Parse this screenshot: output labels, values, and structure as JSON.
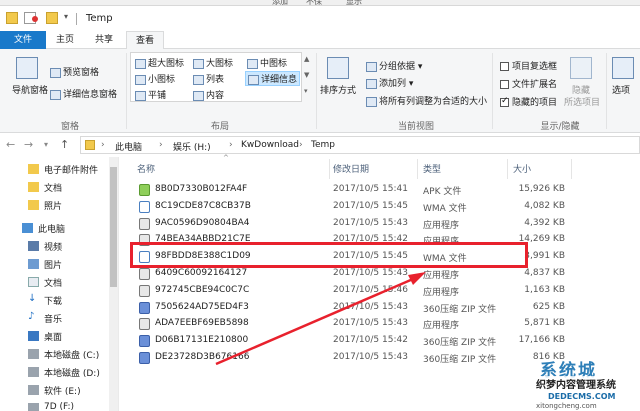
{
  "topstrip": {
    "t1": "添加",
    "t2": "不保",
    "t3": "显示"
  },
  "window": {
    "title": "Temp"
  },
  "tabs": [
    "文件",
    "主页",
    "共享",
    "查看"
  ],
  "ribbon": {
    "nav_pane": "导航窗格",
    "preview_pane": "预览窗格",
    "details_pane": "详细信息窗格",
    "group_panes": "窗格",
    "layout": {
      "extra_large": "超大图标",
      "large": "大图标",
      "medium": "中图标",
      "small": "小图标",
      "list": "列表",
      "details": "详细信息",
      "tiles": "平铺",
      "content": "内容"
    },
    "group_layout": "布局",
    "sort_by": "排序方式",
    "group_by": "分组依据",
    "add_columns": "添加列",
    "size_columns": "将所有列调整为合适的大小",
    "group_current_view": "当前视图",
    "item_checkboxes": "项目复选框",
    "file_extensions": "文件扩展名",
    "hidden_items": "隐藏的项目",
    "hide_selected": "隐藏",
    "hide_selected2": "所选项目",
    "options": "选项",
    "group_show_hide": "显示/隐藏"
  },
  "breadcrumb": [
    "此电脑",
    "娱乐 (H:)",
    "KwDownload",
    "Temp"
  ],
  "sidebar": {
    "items": [
      "电子邮件附件",
      "文档",
      "照片",
      "此电脑",
      "视频",
      "图片",
      "文档",
      "下载",
      "音乐",
      "桌面",
      "本地磁盘 (C:)",
      "本地磁盘 (D:)",
      "软件 (E:)",
      "7D (F:)"
    ]
  },
  "columns": {
    "name": "名称",
    "date": "修改日期",
    "type": "类型",
    "size": "大小"
  },
  "files": [
    {
      "name": "8B0D7330B012FA4F",
      "date": "2017/10/5 15:41",
      "type": "APK 文件",
      "size": "15,926 KB"
    },
    {
      "name": "8C19CDE87C8CB37B",
      "date": "2017/10/5 15:45",
      "type": "WMA 文件",
      "size": "4,082 KB"
    },
    {
      "name": "9AC0596D90804BA4",
      "date": "2017/10/5 15:43",
      "type": "应用程序",
      "size": "4,392 KB"
    },
    {
      "name": "74BEA34ABBD21C7E",
      "date": "2017/10/5 15:42",
      "type": "应用程序",
      "size": "14,269 KB"
    },
    {
      "name": "98FBDD8E388C1D09",
      "date": "2017/10/5 15:45",
      "type": "WMA 文件",
      "size": "3,991 KB"
    },
    {
      "name": "6409C60092164127",
      "date": "2017/10/5 15:43",
      "type": "应用程序",
      "size": "4,837 KB"
    },
    {
      "name": "972745CBE94C0C7C",
      "date": "2017/10/5 15:46",
      "type": "应用程序",
      "size": "1,163 KB"
    },
    {
      "name": "7505624AD75ED4F3",
      "date": "2017/10/5 15:43",
      "type": "360压缩 ZIP 文件",
      "size": "625 KB"
    },
    {
      "name": "ADA7EEBF69EB5898",
      "date": "2017/10/5 15:43",
      "type": "应用程序",
      "size": "5,871 KB"
    },
    {
      "name": "D06B17131E210800",
      "date": "2017/10/5 15:42",
      "type": "360压缩 ZIP 文件",
      "size": "17,166 KB"
    },
    {
      "name": "DE23728D3B676166",
      "date": "2017/10/5 15:43",
      "type": "360压缩 ZIP 文件",
      "size": "816 KB"
    }
  ],
  "watermark": {
    "l1": "系统城",
    "l2": "织梦内容管理系统",
    "l3": "DEDECMS.COM",
    "l4": "xitongcheng.com"
  },
  "colors": {
    "accent": "#1979ca",
    "highlight": "#e8212d"
  }
}
